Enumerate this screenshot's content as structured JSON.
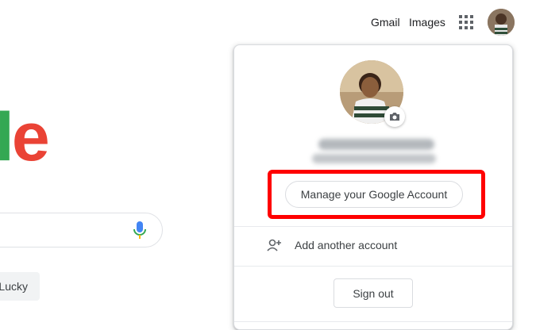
{
  "header": {
    "gmail_label": "Gmail",
    "images_label": "Images",
    "apps_icon": "apps-grid-icon",
    "avatar_icon": "user-avatar-icon"
  },
  "logo": {
    "visible_text_l": "l",
    "visible_text_e": "e",
    "colors": {
      "l": "#34a853",
      "e": "#ea4335"
    }
  },
  "search": {
    "mic_icon": "microphone-icon",
    "mic_colors": [
      "#4285f4",
      "#34a853",
      "#fbbc05",
      "#ea4335"
    ]
  },
  "lucky_button": {
    "label": "Lucky"
  },
  "account_popup": {
    "avatar_icon": "profile-photo",
    "camera_icon": "camera-icon",
    "manage_label": "Manage your Google Account",
    "highlight_color": "#ff0000",
    "add_account_icon": "person-add-icon",
    "add_account_label": "Add another account",
    "sign_out_label": "Sign out"
  }
}
